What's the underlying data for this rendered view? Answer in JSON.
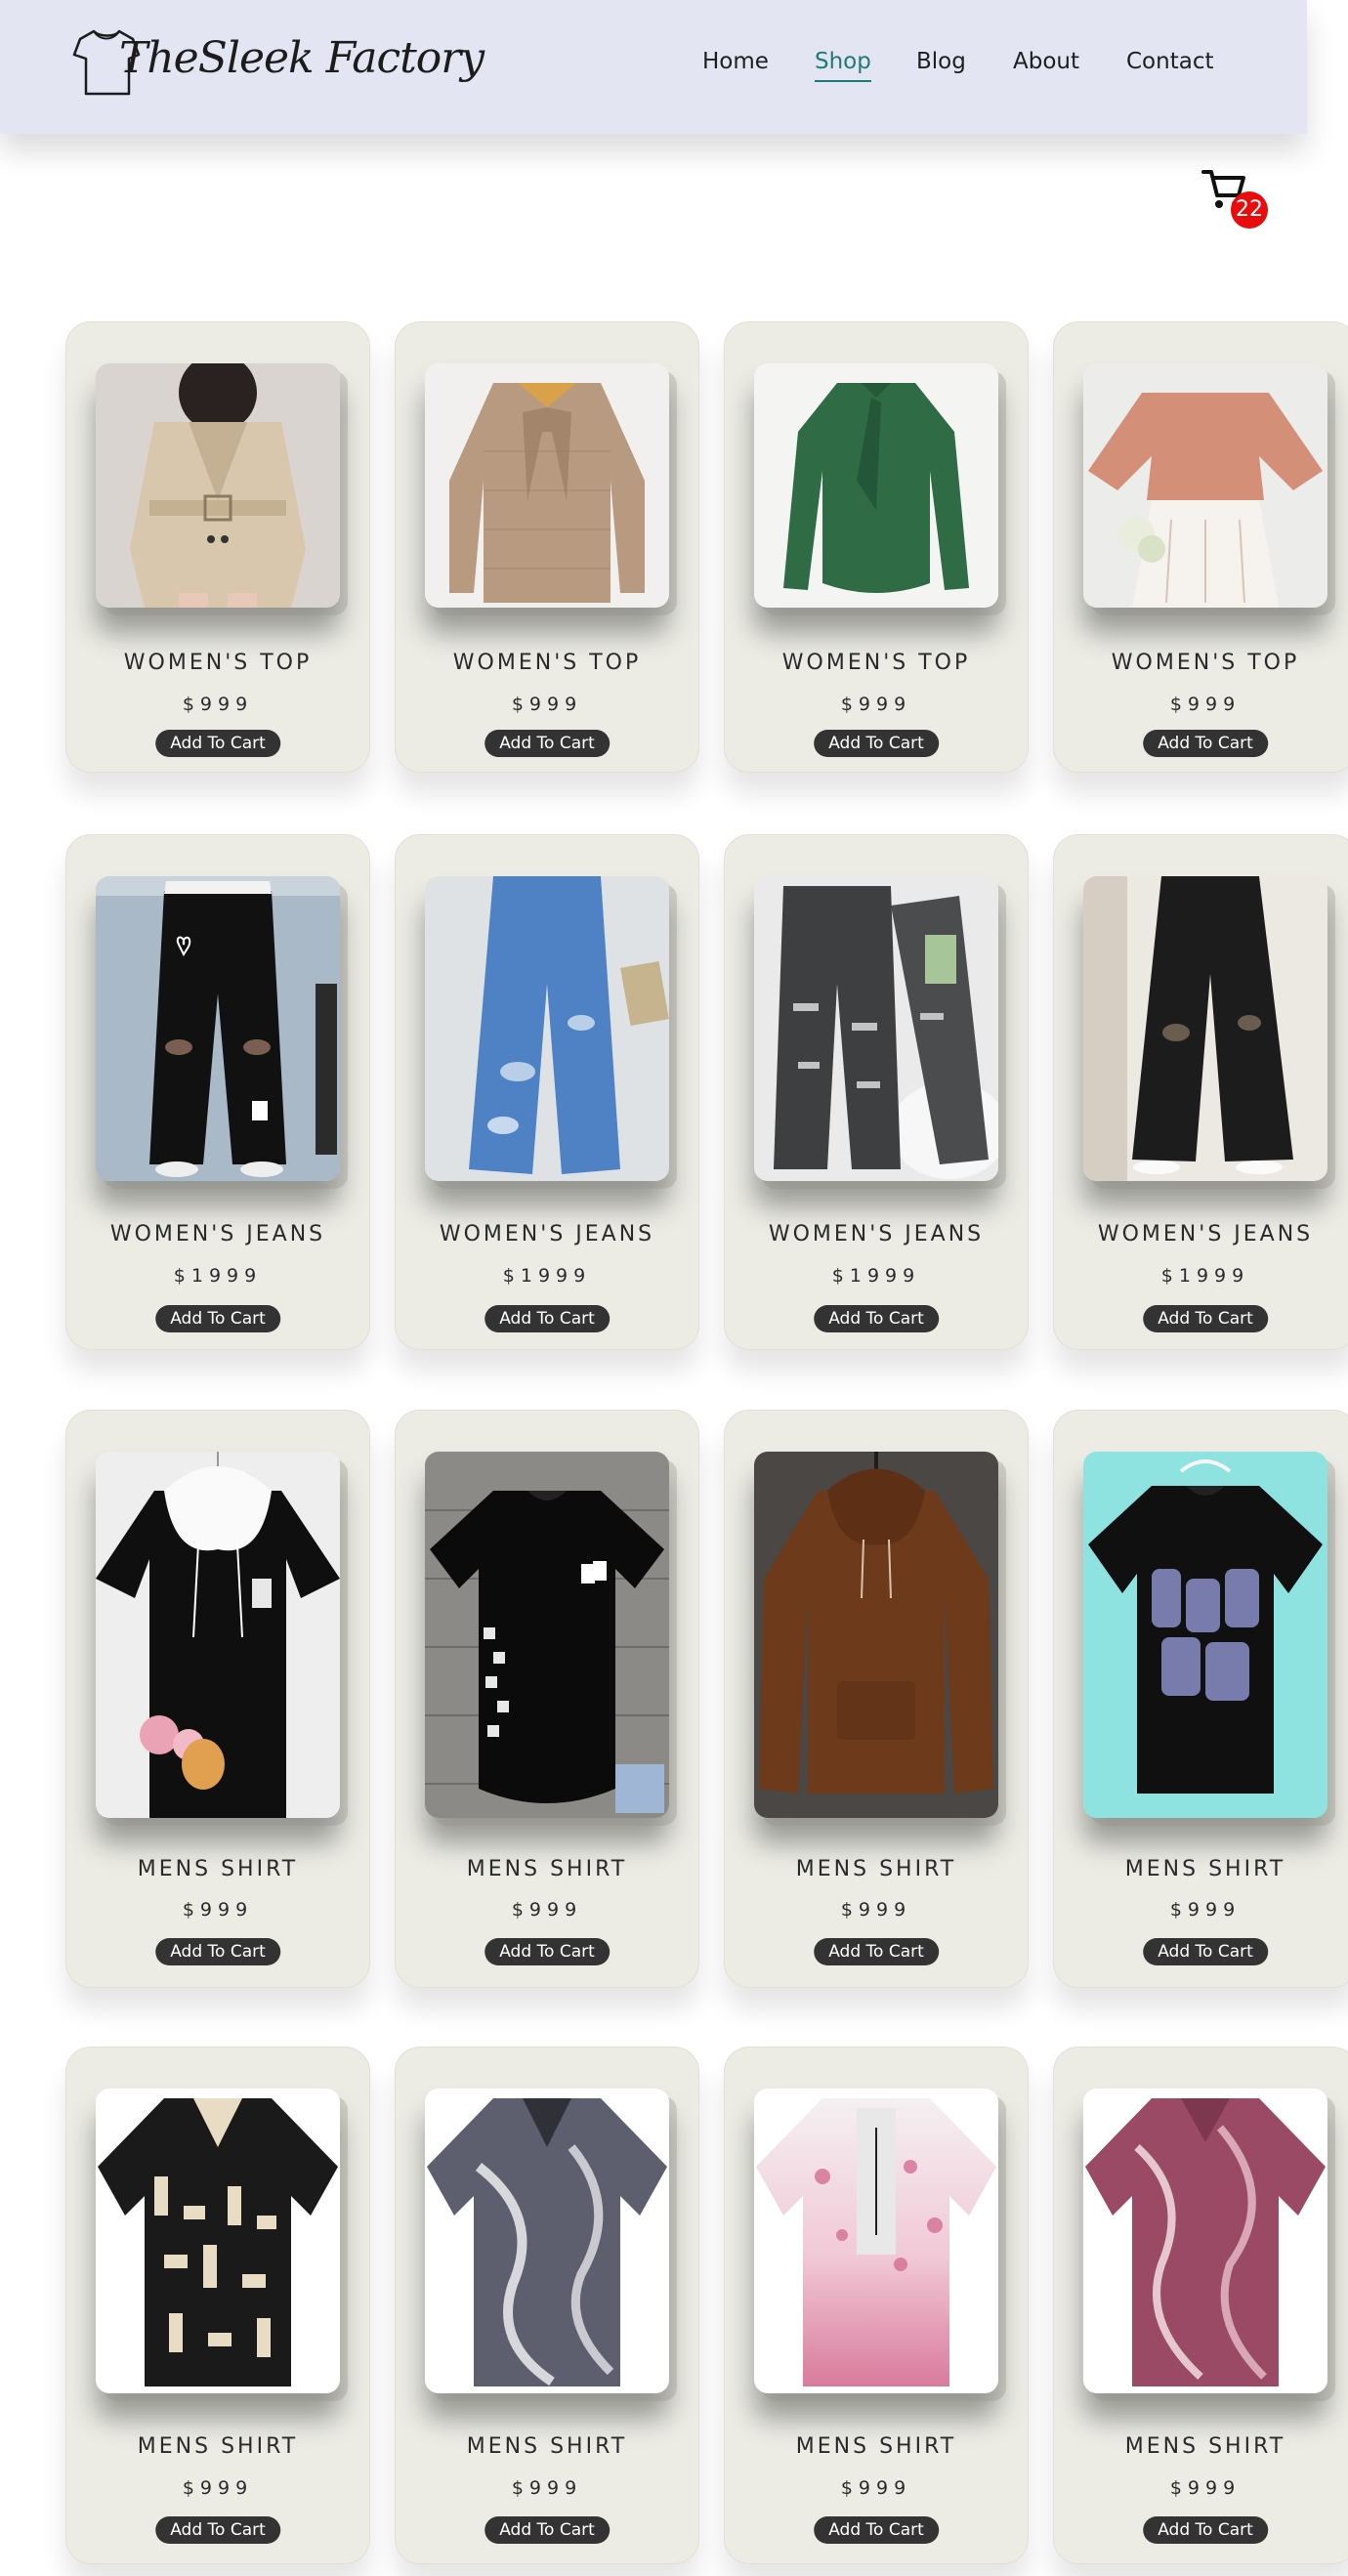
{
  "header": {
    "logo_text": "TheSleek Factory",
    "nav": [
      {
        "label": "Home",
        "active": false
      },
      {
        "label": "Shop",
        "active": true
      },
      {
        "label": "Blog",
        "active": false
      },
      {
        "label": "About",
        "active": false
      },
      {
        "label": "Contact",
        "active": false
      }
    ]
  },
  "cart": {
    "icon": "shopping-cart-icon",
    "count": "22"
  },
  "colors": {
    "header_bg": "#e3e6f2",
    "active_nav": "#1f7a73",
    "badge": "#e80c0c",
    "card_bg": "#ecece5",
    "button_bg": "#333333"
  },
  "products": {
    "row1": [
      {
        "name": "WOMEN'S TOP",
        "price": "$999",
        "button": "Add To Cart"
      },
      {
        "name": "WOMEN'S TOP",
        "price": "$999",
        "button": "Add To Cart"
      },
      {
        "name": "WOMEN'S TOP",
        "price": "$999",
        "button": "Add To Cart"
      },
      {
        "name": "WOMEN'S TOP",
        "price": "$999",
        "button": "Add To Cart"
      }
    ],
    "row2": [
      {
        "name": "WOMEN'S JEANS",
        "price": "$1999",
        "button": "Add To Cart"
      },
      {
        "name": "WOMEN'S JEANS",
        "price": "$1999",
        "button": "Add To Cart"
      },
      {
        "name": "WOMEN'S JEANS",
        "price": "$1999",
        "button": "Add To Cart"
      },
      {
        "name": "WOMEN'S JEANS",
        "price": "$1999",
        "button": "Add To Cart"
      }
    ],
    "row3": [
      {
        "name": "MENS SHIRT",
        "price": "$999",
        "button": "Add To Cart"
      },
      {
        "name": "MENS SHIRT",
        "price": "$999",
        "button": "Add To Cart"
      },
      {
        "name": "MENS SHIRT",
        "price": "$999",
        "button": "Add To Cart"
      },
      {
        "name": "MENS SHIRT",
        "price": "$999",
        "button": "Add To Cart"
      }
    ],
    "row4": [
      {
        "name": "MENS SHIRT",
        "price": "$999",
        "button": "Add To Cart"
      },
      {
        "name": "MENS SHIRT",
        "price": "$999",
        "button": "Add To Cart"
      },
      {
        "name": "MENS SHIRT",
        "price": "$999",
        "button": "Add To Cart"
      },
      {
        "name": "MENS SHIRT",
        "price": "$999",
        "button": "Add To Cart"
      }
    ]
  }
}
